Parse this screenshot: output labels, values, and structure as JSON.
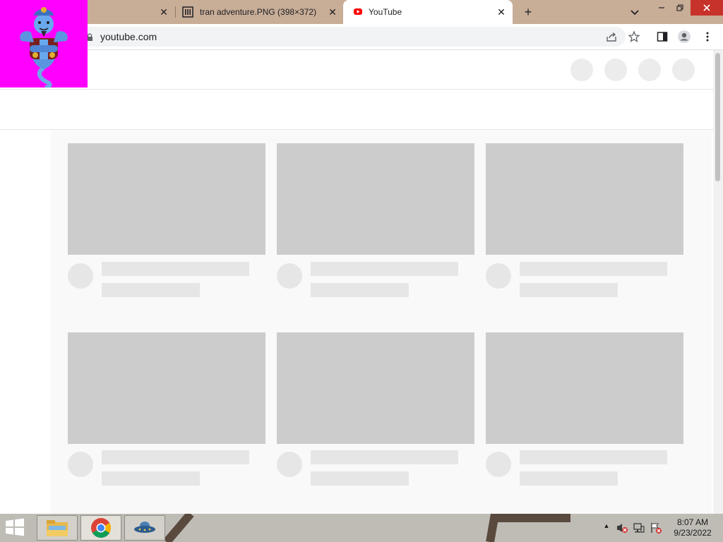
{
  "browser": {
    "tabs": [
      {
        "title": "",
        "close_glyph": "✕"
      },
      {
        "title": "tran adventure.PNG (398×372)",
        "close_glyph": "✕"
      },
      {
        "title": "YouTube",
        "close_glyph": "✕"
      }
    ],
    "new_tab_glyph": "+",
    "url": "youtube.com"
  },
  "taskbar": {
    "time": "8:07 AM",
    "date": "9/23/2022",
    "tray_arrow": "▲"
  },
  "colors": {
    "tabstrip": "#c8ad97",
    "overlay": "#ff00ff",
    "skeleton_thumb": "#cccccc",
    "skeleton_text": "#e6e6e6",
    "taskbar": "#bfbcb6"
  }
}
